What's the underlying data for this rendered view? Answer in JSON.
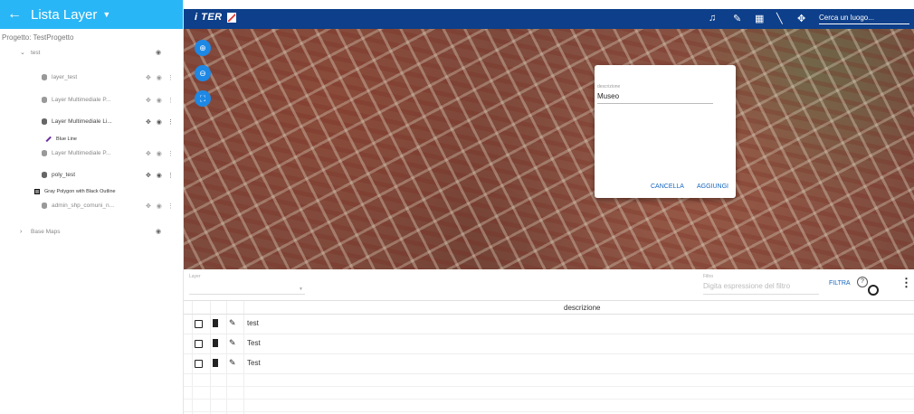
{
  "sidebar": {
    "title": "Lista Layer",
    "project": "Progetto: TestProgetto",
    "group_test": "test",
    "layers": [
      {
        "label": "layer_test"
      },
      {
        "label": "Layer Multimediale P..."
      },
      {
        "label": "Layer Multimediale Li...",
        "legend": "Blue Line"
      },
      {
        "label": "Layer Multimediale P..."
      },
      {
        "label": "poly_test",
        "legend": "Gray Polygon with Black Outline"
      },
      {
        "label": "admin_shp_comuni_n..."
      }
    ],
    "group_base": "Base Maps"
  },
  "topbar": {
    "logo_text": "i TER",
    "search_placeholder": "Cerca un luogo..."
  },
  "dialog": {
    "field_label": "descrizione",
    "field_value": "Museo",
    "cancel_label": "CANCELLA",
    "add_label": "AGGIUNGI"
  },
  "filterbar": {
    "layer_label": "Layer",
    "filter_label": "Filtro",
    "filter_placeholder": "Digita espressione del filtro",
    "filter_button": "FILTRA",
    "help_glyph": "?"
  },
  "table": {
    "header": "descrizione",
    "rows": [
      "test",
      "Test",
      "Test"
    ]
  },
  "colors": {
    "sidebar_header": "#29b6f6",
    "topbar": "#0d3f8a",
    "accent": "#1565c0"
  },
  "icons": [
    "arrow-back-icon",
    "bell-icon",
    "pencil-icon",
    "grid-icon",
    "ruler-icon",
    "move-icon",
    "eye-icon",
    "target-icon",
    "more-vert-icon",
    "zoom-in-icon",
    "zoom-out-icon",
    "fullscreen-icon",
    "trash-icon",
    "checkbox-icon",
    "help-icon"
  ]
}
